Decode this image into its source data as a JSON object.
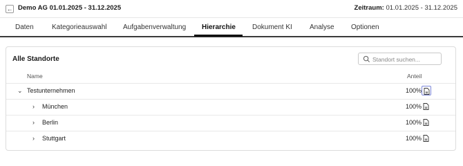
{
  "header": {
    "title": "Demo AG 01.01.2025 - 31.12.2025",
    "back_icon": "arrow-left-icon",
    "period_label": "Zeitraum:",
    "period_value": "01.01.2025 - 31.12.2025"
  },
  "tabs": [
    {
      "label": "Daten"
    },
    {
      "label": "Kategorieauswahl"
    },
    {
      "label": "Aufgabenverwaltung"
    },
    {
      "label": "Hierarchie",
      "active": true
    },
    {
      "label": "Dokument KI"
    },
    {
      "label": "Analyse"
    },
    {
      "label": "Optionen"
    }
  ],
  "panel": {
    "title": "Alle Standorte",
    "search_placeholder": "Standort suchen...",
    "columns": {
      "name": "Name",
      "share": "Anteil"
    },
    "rows": [
      {
        "name": "Testunternehmen",
        "share": "100%",
        "expanded": true,
        "level": 0
      },
      {
        "name": "München",
        "share": "100%",
        "expanded": false,
        "level": 1
      },
      {
        "name": "Berlin",
        "share": "100%",
        "expanded": false,
        "level": 1
      },
      {
        "name": "Stuttgart",
        "share": "100%",
        "expanded": false,
        "level": 1
      }
    ]
  },
  "colors": {
    "accent": "#111111",
    "focus_ring": "#7b86d8",
    "border": "#dcdcdc"
  }
}
